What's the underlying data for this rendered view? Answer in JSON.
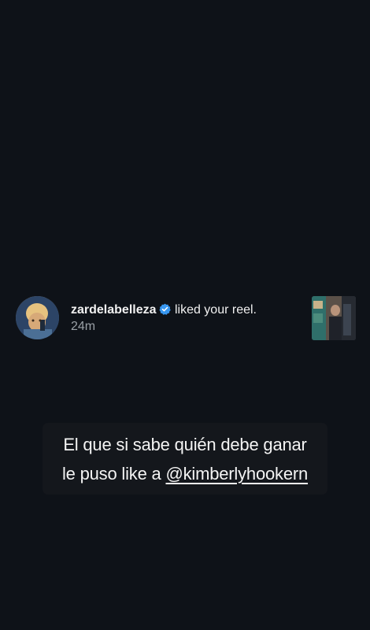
{
  "notification": {
    "username": "zardelabelleza",
    "action": "liked your reel.",
    "time": "24m",
    "verified": true,
    "avatar_icon": "profile-avatar",
    "thumbnail_icon": "reel-thumbnail"
  },
  "caption": {
    "line1": "El que si sabe quién debe ganar",
    "line2_prefix": "le puso like a ",
    "mention": "@kimberlyhookern"
  },
  "colors": {
    "background": "#0e1218",
    "verified_badge": "#3897f0",
    "caption_bg": "#14171c",
    "time_text": "#9aa0a6"
  }
}
